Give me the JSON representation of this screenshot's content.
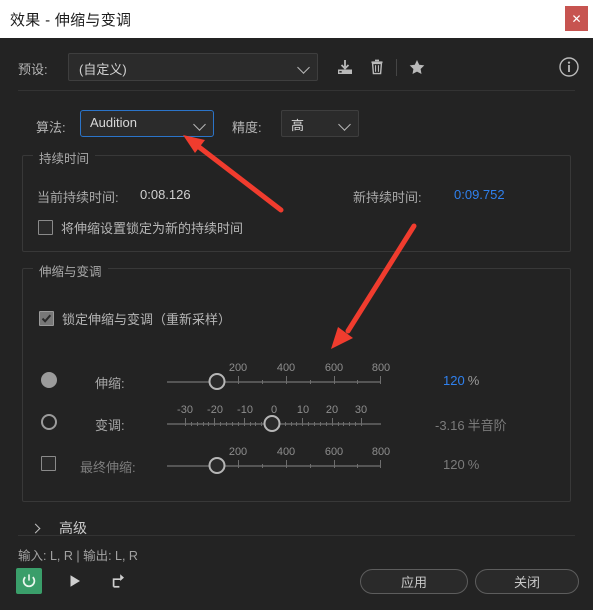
{
  "window": {
    "title": "效果 - 伸缩与变调",
    "close_label": "✕"
  },
  "preset": {
    "label": "预设:",
    "value": "(自定义)",
    "icons": {
      "save": "save-preset-icon",
      "delete": "delete-preset-icon",
      "favorite": "favorite-star-icon",
      "info": "info-icon"
    }
  },
  "algorithm": {
    "label": "算法:",
    "value": "Audition",
    "precision_label": "精度:",
    "precision_value": "高"
  },
  "duration": {
    "title": "持续时间",
    "current_label": "当前持续时间:",
    "current_value": "0:08.126",
    "new_label": "新持续时间:",
    "new_value": "0:09.752",
    "lock_checkbox_label": "将伸缩设置锁定为新的持续时间",
    "lock_checked": false
  },
  "stretch_pitch": {
    "title": "伸缩与变调",
    "lock_label": "锁定伸缩与变调（重新采样）",
    "lock_checked": true,
    "rows": [
      {
        "label": "伸缩:",
        "value_number": "120",
        "value_unit": "%",
        "tick_labels": [
          "200",
          "400",
          "600",
          "800"
        ],
        "selected": true
      },
      {
        "label": "变调:",
        "value_number": "-3.16",
        "value_unit": "半音阶",
        "tick_labels": [
          "-30",
          "-20",
          "-10",
          "0",
          "10",
          "20",
          "30"
        ],
        "selected": false
      },
      {
        "label": "最终伸缩:",
        "value_number": "120",
        "value_unit": "%",
        "tick_labels": [
          "200",
          "400",
          "600",
          "800"
        ],
        "selected": false
      }
    ]
  },
  "advanced": {
    "label": "高级",
    "expanded": false
  },
  "footer": {
    "status": "输入: L, R | 输出: L, R",
    "power_icon": "power-toggle-icon",
    "play_icon": "play-icon",
    "export_icon": "export-icon",
    "apply_label": "应用",
    "close_label": "关闭"
  },
  "annotations": {
    "arrow_color": "#f03c2e",
    "arrow_1_target": "algorithm-select",
    "arrow_2_target": "stretch-slider"
  }
}
